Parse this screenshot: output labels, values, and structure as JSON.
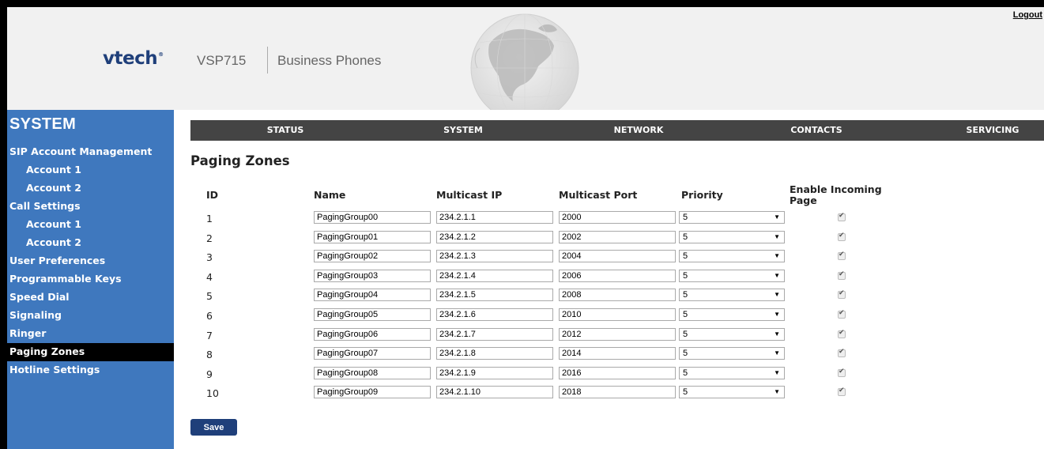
{
  "header": {
    "logout_label": "Logout",
    "brand": "vtech",
    "brand_mark": "®",
    "model": "VSP715",
    "product": "Business Phones",
    "globe_icon": "globe-icon"
  },
  "sidebar": {
    "title": "SYSTEM",
    "items": [
      {
        "label": "SIP Account Management",
        "level": 0
      },
      {
        "label": "Account 1",
        "level": 1
      },
      {
        "label": "Account 2",
        "level": 1
      },
      {
        "label": "Call Settings",
        "level": 0
      },
      {
        "label": "Account 1",
        "level": 1
      },
      {
        "label": "Account 2",
        "level": 1
      },
      {
        "label": "User Preferences",
        "level": 0
      },
      {
        "label": "Programmable Keys",
        "level": 0
      },
      {
        "label": "Speed Dial",
        "level": 0
      },
      {
        "label": "Signaling",
        "level": 0
      },
      {
        "label": "Ringer",
        "level": 0
      },
      {
        "label": "Paging Zones",
        "level": 0,
        "active": true
      },
      {
        "label": "Hotline Settings",
        "level": 0
      }
    ]
  },
  "nav": {
    "items": [
      "STATUS",
      "SYSTEM",
      "NETWORK",
      "CONTACTS",
      "SERVICING"
    ]
  },
  "main": {
    "title": "Paging Zones",
    "columns": {
      "id": "ID",
      "name": "Name",
      "multicast_ip": "Multicast IP",
      "multicast_port": "Multicast Port",
      "priority": "Priority",
      "enable_line1": "Enable Incoming",
      "enable_line2": "Page"
    },
    "rows": [
      {
        "id": "1",
        "name": "PagingGroup00",
        "ip": "234.2.1.1",
        "port": "2000",
        "priority": "5",
        "enabled": true
      },
      {
        "id": "2",
        "name": "PagingGroup01",
        "ip": "234.2.1.2",
        "port": "2002",
        "priority": "5",
        "enabled": true
      },
      {
        "id": "3",
        "name": "PagingGroup02",
        "ip": "234.2.1.3",
        "port": "2004",
        "priority": "5",
        "enabled": true
      },
      {
        "id": "4",
        "name": "PagingGroup03",
        "ip": "234.2.1.4",
        "port": "2006",
        "priority": "5",
        "enabled": true
      },
      {
        "id": "5",
        "name": "PagingGroup04",
        "ip": "234.2.1.5",
        "port": "2008",
        "priority": "5",
        "enabled": true
      },
      {
        "id": "6",
        "name": "PagingGroup05",
        "ip": "234.2.1.6",
        "port": "2010",
        "priority": "5",
        "enabled": true
      },
      {
        "id": "7",
        "name": "PagingGroup06",
        "ip": "234.2.1.7",
        "port": "2012",
        "priority": "5",
        "enabled": true
      },
      {
        "id": "8",
        "name": "PagingGroup07",
        "ip": "234.2.1.8",
        "port": "2014",
        "priority": "5",
        "enabled": true
      },
      {
        "id": "9",
        "name": "PagingGroup08",
        "ip": "234.2.1.9",
        "port": "2016",
        "priority": "5",
        "enabled": true
      },
      {
        "id": "10",
        "name": "PagingGroup09",
        "ip": "234.2.1.10",
        "port": "2018",
        "priority": "5",
        "enabled": true
      }
    ],
    "save_label": "Save"
  },
  "colors": {
    "sidebar_bg": "#3f78be",
    "nav_bg": "#444444",
    "brand": "#1f3f7a",
    "active_item": "#000000"
  }
}
